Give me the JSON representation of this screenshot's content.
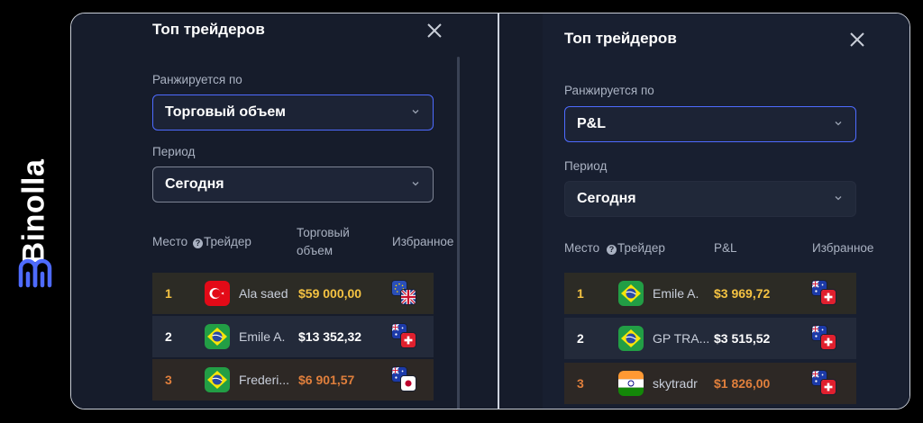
{
  "brand": {
    "name": "Binolla",
    "logo_icon": "binolla-logo-icon"
  },
  "panels": [
    {
      "title": "Топ трейдеров",
      "ranked_by_label": "Ранжируется по",
      "ranked_by_value": "Торговый объем",
      "period_label": "Период",
      "period_value": "Сегодня",
      "columns": {
        "place": "Место",
        "trader": "Трейдер",
        "metric": "Торговый\nобъем",
        "favorites": "Избранное"
      },
      "rows": [
        {
          "place": "1",
          "country": "turkey",
          "name": "Ala saed",
          "value": "$59 000,00",
          "fav": [
            "eu",
            "uk"
          ]
        },
        {
          "place": "2",
          "country": "brazil",
          "name": "Emile A.",
          "value": "$13 352,32",
          "fav": [
            "au",
            "ch"
          ]
        },
        {
          "place": "3",
          "country": "brazil",
          "name": "Frederi...",
          "value": "$6 901,57",
          "fav": [
            "au",
            "jp"
          ]
        }
      ]
    },
    {
      "title": "Топ трейдеров",
      "ranked_by_label": "Ранжируется по",
      "ranked_by_value": "P&L",
      "period_label": "Период",
      "period_value": "Сегодня",
      "columns": {
        "place": "Место",
        "trader": "Трейдер",
        "metric": "P&L",
        "favorites": "Избранное"
      },
      "rows": [
        {
          "place": "1",
          "country": "brazil",
          "name": "Emile A.",
          "value": "$3 969,72",
          "fav": [
            "au",
            "ch"
          ]
        },
        {
          "place": "2",
          "country": "brazil",
          "name": "GP TRA...",
          "value": "$3 515,52",
          "fav": [
            "au",
            "ch"
          ]
        },
        {
          "place": "3",
          "country": "india",
          "name": "skytradr",
          "value": "$1 826,00",
          "fav": [
            "au",
            "ch"
          ]
        }
      ]
    }
  ],
  "colors": {
    "gold": "#f5c342",
    "bronze": "#e07f3c",
    "silver": "#ffffff",
    "accent": "#4e6bff",
    "row1_bg": "#2c2b25",
    "row2_bg": "#232a3a",
    "row3_bg": "#2d2825"
  }
}
